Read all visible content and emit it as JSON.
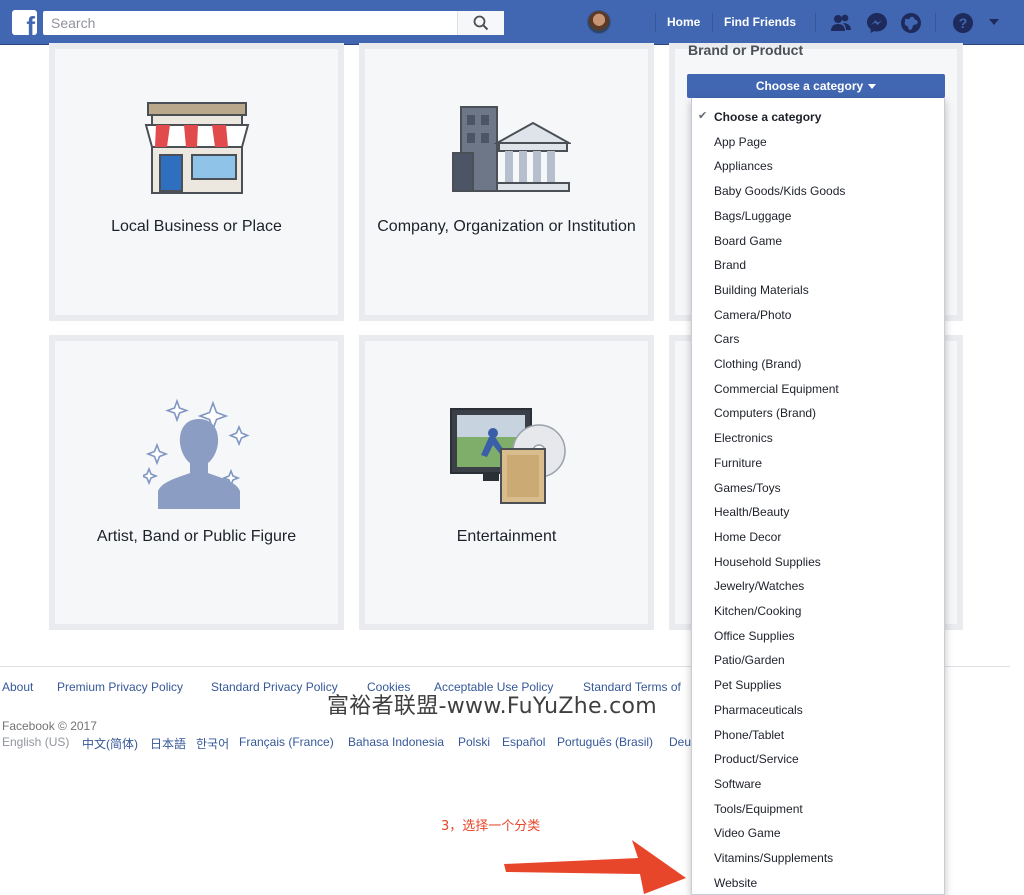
{
  "topbar": {
    "logo_letter": "f",
    "search_placeholder": "Search",
    "nav_home": "Home",
    "nav_find_friends": "Find Friends"
  },
  "cards": [
    {
      "label": "Local Business or Place"
    },
    {
      "label": "Company, Organization or Institution"
    },
    {
      "label": "Artist, Band or Public Figure"
    },
    {
      "label": "Entertainment"
    }
  ],
  "form": {
    "heading": "Brand or Product",
    "category_button": "Choose a category"
  },
  "dropdown": {
    "items": [
      "Choose a category",
      "App Page",
      "Appliances",
      "Baby Goods/Kids Goods",
      "Bags/Luggage",
      "Board Game",
      "Brand",
      "Building Materials",
      "Camera/Photo",
      "Cars",
      "Clothing (Brand)",
      "Commercial Equipment",
      "Computers (Brand)",
      "Electronics",
      "Furniture",
      "Games/Toys",
      "Health/Beauty",
      "Home Decor",
      "Household Supplies",
      "Jewelry/Watches",
      "Kitchen/Cooking",
      "Office Supplies",
      "Patio/Garden",
      "Pet Supplies",
      "Pharmaceuticals",
      "Phone/Tablet",
      "Product/Service",
      "Software",
      "Tools/Equipment",
      "Video Game",
      "Vitamins/Supplements",
      "Website"
    ]
  },
  "footer": {
    "links": [
      "About",
      "Premium Privacy Policy",
      "Standard Privacy Policy",
      "Cookies",
      "Acceptable Use Policy",
      "Standard Terms of"
    ],
    "copyright": "Facebook © 2017",
    "current_language": "English (US)",
    "languages": [
      "中文(简体)",
      "日本語",
      "한국어",
      "Français (France)",
      "Bahasa Indonesia",
      "Polski",
      "Español",
      "Português (Brasil)",
      "Deu"
    ]
  },
  "overlay": {
    "watermark": "富裕者联盟-www.FuYuZhe.com",
    "annotation": "3，选择一个分类"
  },
  "colors": {
    "facebook_blue": "#4267b2",
    "link_blue": "#365899",
    "annotation_red": "#e8462a"
  }
}
